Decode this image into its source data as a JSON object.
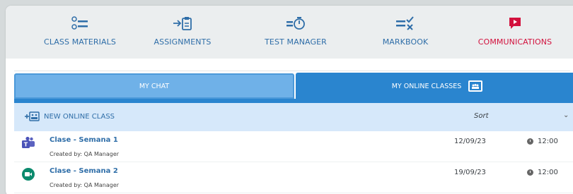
{
  "nav": {
    "items": [
      {
        "label": "CLASS MATERIALS",
        "icon": "list-icon"
      },
      {
        "label": "ASSIGNMENTS",
        "icon": "clipboard-arrow-icon"
      },
      {
        "label": "TEST MANAGER",
        "icon": "timer-icon"
      },
      {
        "label": "MARKBOOK",
        "icon": "checklist-icon"
      },
      {
        "label": "COMMUNICATIONS",
        "icon": "video-play-icon"
      }
    ],
    "active_color": "#d2113d",
    "default_color": "#2f6ea8"
  },
  "tabs": {
    "chat_label": "MY CHAT",
    "online_label": "MY ONLINE CLASSES"
  },
  "toolbar": {
    "new_label": "NEW ONLINE CLASS",
    "sort_label": "Sort"
  },
  "classes": [
    {
      "title": "Clase - Semana 1",
      "creator": "Created by: QA Manager",
      "date": "12/09/23",
      "time": "12:00",
      "app": "microsoft-teams-icon"
    },
    {
      "title": "Clase - Semana 2",
      "creator": "Created by: QA Manager",
      "date": "19/09/23",
      "time": "12:00",
      "app": "google-meet-icon"
    }
  ]
}
